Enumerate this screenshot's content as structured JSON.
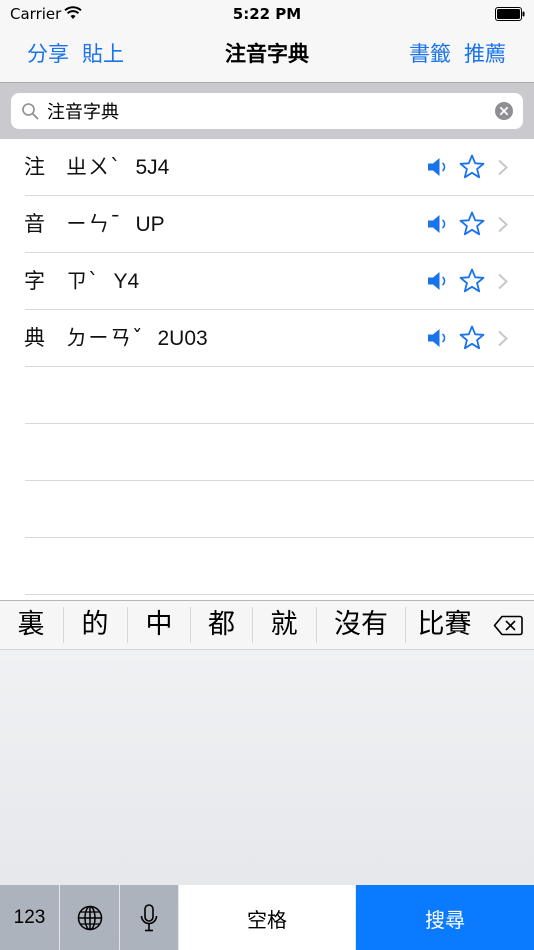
{
  "status_bar": {
    "carrier": "Carrier",
    "time": "5:22 PM"
  },
  "nav": {
    "share_label": "分享",
    "paste_label": "貼上",
    "title": "注音字典",
    "bookmarks_label": "書籤",
    "recommend_label": "推薦"
  },
  "search": {
    "value": "注音字典"
  },
  "results": [
    {
      "char": "注",
      "zhuyin": "ㄓㄨˋ",
      "code": "5J4"
    },
    {
      "char": "音",
      "zhuyin": "ㄧㄣˉ",
      "code": "UP"
    },
    {
      "char": "字",
      "zhuyin": "ㄗˋ",
      "code": "Y4"
    },
    {
      "char": "典",
      "zhuyin": "ㄉㄧㄢˇ",
      "code": "2U03"
    }
  ],
  "icons": {
    "speaker": "speaker-icon",
    "star": "star-icon",
    "chevron": "chevron-right-icon"
  },
  "keyboard": {
    "candidates": [
      "裏",
      "的",
      "中",
      "都",
      "就",
      "沒有",
      "比賽"
    ],
    "num_key": "123",
    "space_label": "空格",
    "search_label": "搜尋"
  },
  "colors": {
    "accent": "#1a73e8",
    "search_key": "#0a7aff"
  }
}
